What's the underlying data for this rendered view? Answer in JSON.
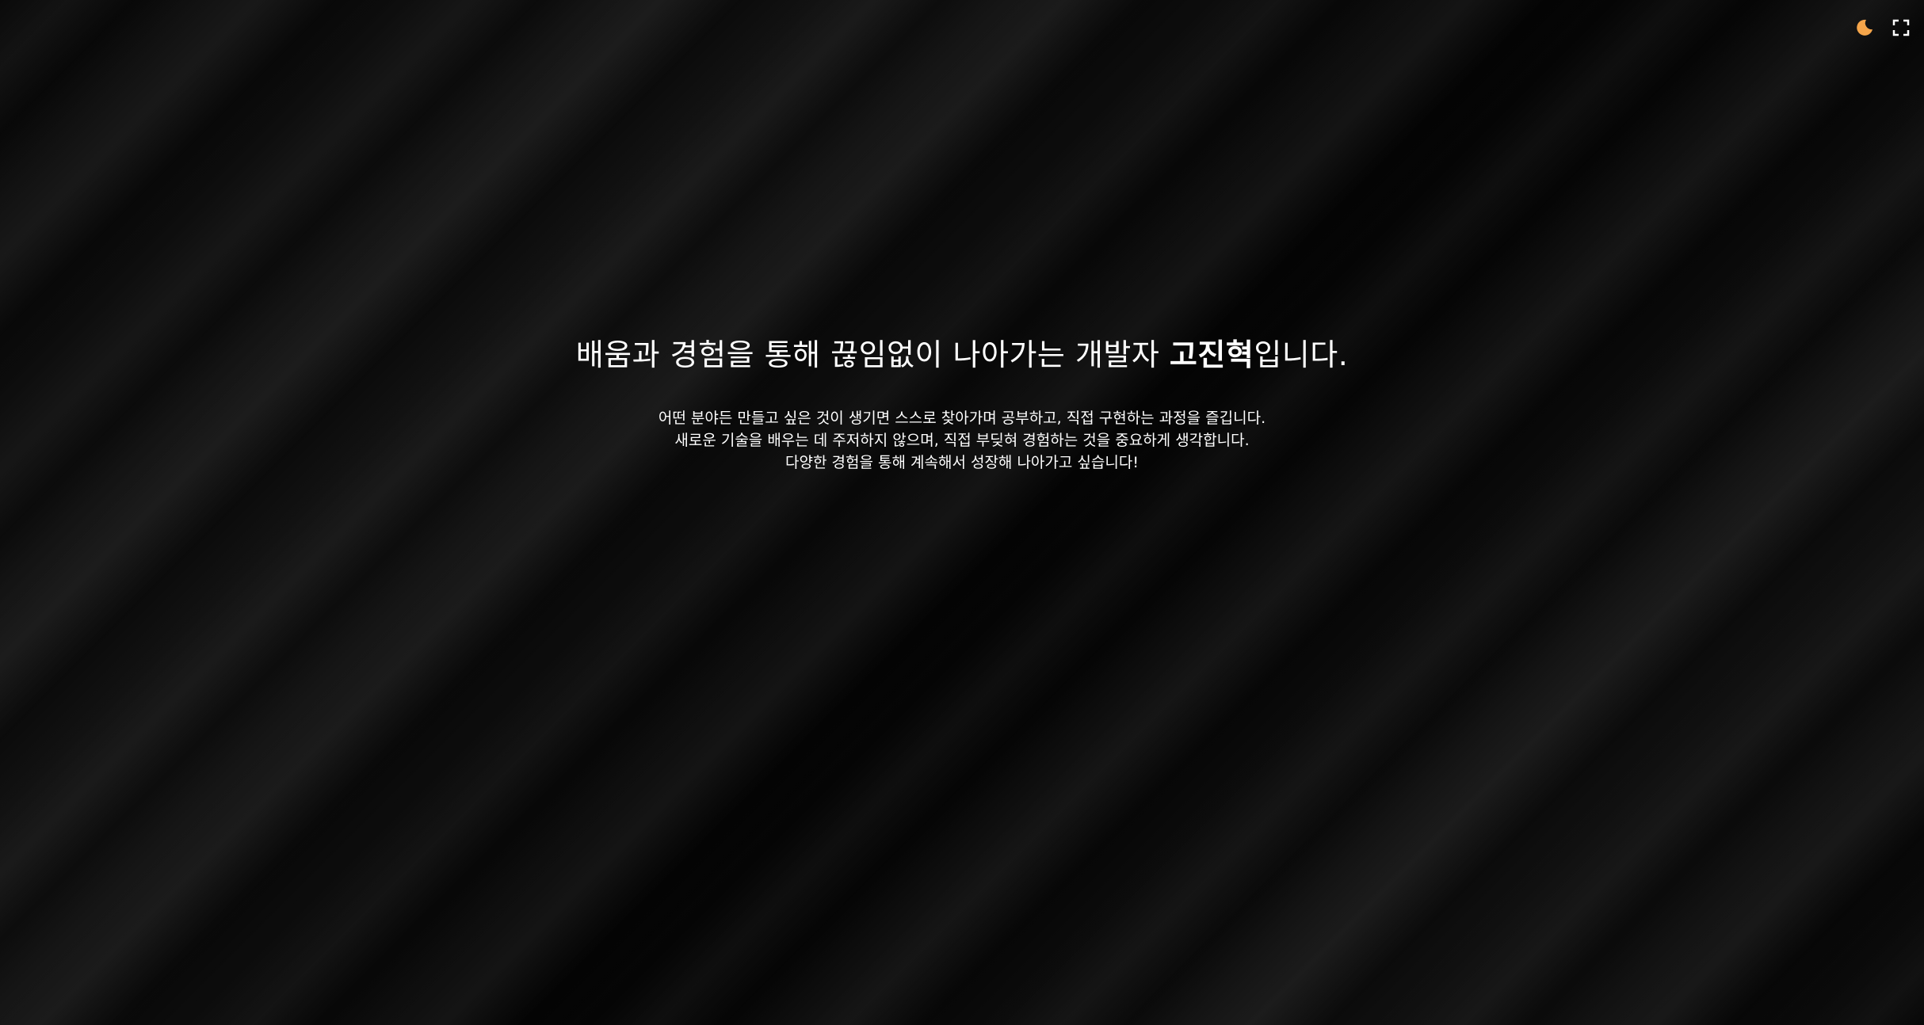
{
  "controls": {
    "theme_icon": "moon-icon",
    "fullscreen_icon": "fullscreen-icon",
    "accent": "#f5a54a"
  },
  "hero": {
    "headline_prefix": "배움과 경험을 통해 끊임없이 나아가는 개발자 ",
    "headline_name": "고진혁",
    "headline_suffix": "입니다.",
    "lines": [
      "어떤 분야든 만들고 싶은 것이 생기면 스스로 찾아가며 공부하고, 직접 구현하는 과정을 즐깁니다.",
      "새로운 기술을 배우는 데 주저하지 않으며, 직접 부딪혀 경험하는 것을 중요하게 생각합니다.",
      "다양한 경험을 통해 계속해서 성장해 나아가고 싶습니다!"
    ]
  }
}
